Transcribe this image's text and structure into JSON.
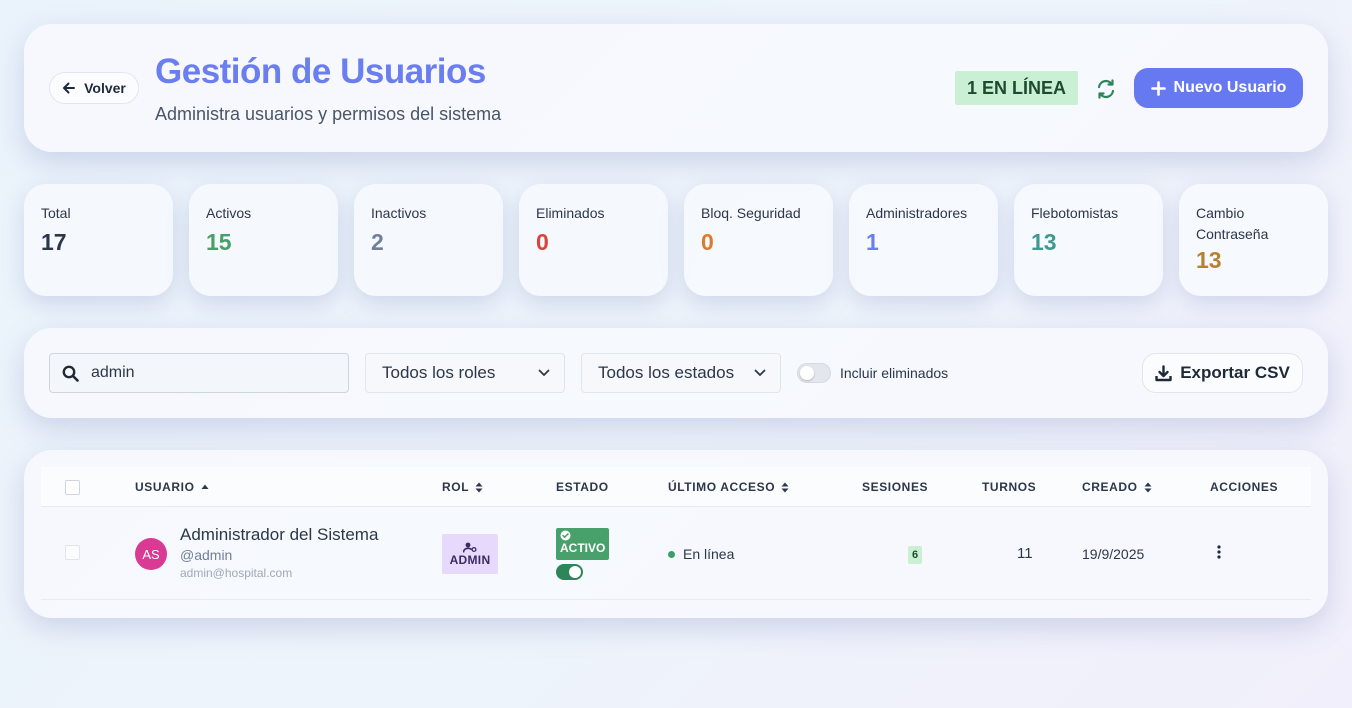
{
  "header": {
    "back_label": "Volver",
    "title": "Gestión de Usuarios",
    "subtitle": "Administra usuarios y permisos del sistema",
    "online_badge": "1 EN LÍNEA",
    "new_user_label": "Nuevo Usuario"
  },
  "stats": [
    {
      "label": "Total",
      "value": "17",
      "color": "#2d3748"
    },
    {
      "label": "Activos",
      "value": "15",
      "color": "#48a068"
    },
    {
      "label": "Inactivos",
      "value": "2",
      "color": "#718096"
    },
    {
      "label": "Eliminados",
      "value": "0",
      "color": "#d9443c"
    },
    {
      "label": "Bloq. Seguridad",
      "value": "0",
      "color": "#dd7a2b"
    },
    {
      "label": "Administradores",
      "value": "1",
      "color": "#6b7ef0"
    },
    {
      "label": "Flebotomistas",
      "value": "13",
      "color": "#3f9a8e"
    },
    {
      "label": "Cambio Contraseña",
      "value": "13",
      "color": "#b7822f"
    }
  ],
  "filters": {
    "search_value": "admin",
    "role_select": "Todos los roles",
    "status_select": "Todos los estados",
    "include_deleted_label": "Incluir eliminados",
    "export_label": "Exportar CSV"
  },
  "table": {
    "columns": {
      "user": "USUARIO",
      "role": "ROL",
      "status": "ESTADO",
      "last_access": "ÚLTIMO ACCESO",
      "sessions": "SESIONES",
      "shifts": "TURNOS",
      "created": "CREADO",
      "actions": "ACCIONES"
    },
    "rows": [
      {
        "initials": "AS",
        "name": "Administrador del Sistema",
        "username": "@admin",
        "email": "admin@hospital.com",
        "role": "ADMIN",
        "status": "ACTIVO",
        "last_access": "En línea",
        "sessions": "6",
        "shifts": "11",
        "created": "19/9/2025"
      }
    ]
  },
  "icons": {
    "back": "arrow-left-icon",
    "refresh": "refresh-icon",
    "add": "plus-icon",
    "search": "search-icon",
    "download": "download-icon",
    "sort": "sort-icon",
    "more": "more-vertical-icon"
  }
}
